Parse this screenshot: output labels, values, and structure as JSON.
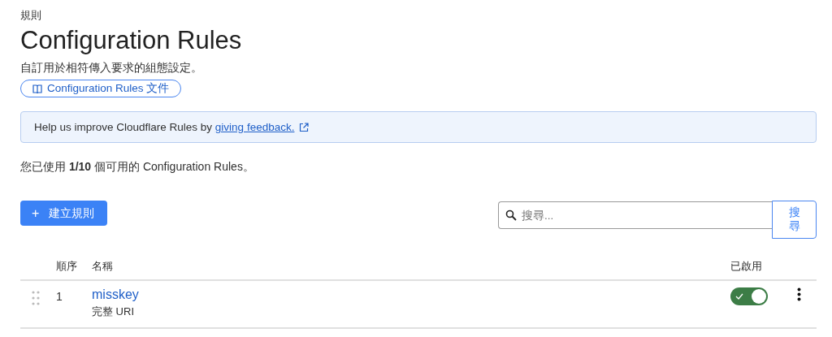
{
  "breadcrumb": "規則",
  "title": "Configuration Rules",
  "subtitle": "自訂用於相符傳入要求的組態設定。",
  "docs_link": "Configuration Rules 文件",
  "banner": {
    "text": "Help us improve Cloudflare Rules by ",
    "link": "giving feedback."
  },
  "usage": "您已使用 **1/10** 個可用的 Configuration Rules。",
  "create_button": {
    "icon": "+",
    "label": "建立規則"
  },
  "search": {
    "placeholder": "搜尋...",
    "button": "搜尋"
  },
  "table": {
    "columns": [
      "順序",
      "名稱",
      "已啟用"
    ],
    "rows": [
      {
        "order": "1",
        "name": "misskey",
        "detail": "完整 URI",
        "on": true
      }
    ]
  }
}
